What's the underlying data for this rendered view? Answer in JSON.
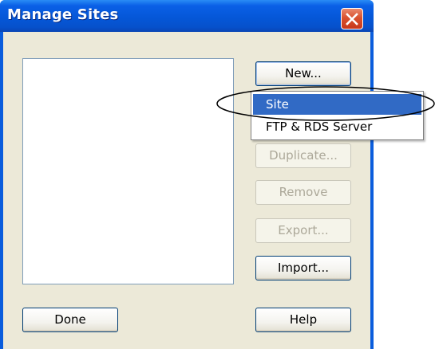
{
  "window": {
    "title": "Manage Sites"
  },
  "buttons": {
    "new": "New...",
    "duplicate": "Duplicate...",
    "remove": "Remove",
    "export": "Export...",
    "import": "Import...",
    "done": "Done",
    "help": "Help"
  },
  "new_menu": {
    "items": [
      {
        "label": "Site",
        "selected": true
      },
      {
        "label": "FTP & RDS Server",
        "selected": false
      }
    ]
  },
  "icons": {
    "close": "close-icon"
  },
  "colors": {
    "titlebar": "#0a5ddd",
    "close_button": "#d9512e",
    "dialog_background": "#ece9d8",
    "menu_highlight": "#316ac5"
  }
}
